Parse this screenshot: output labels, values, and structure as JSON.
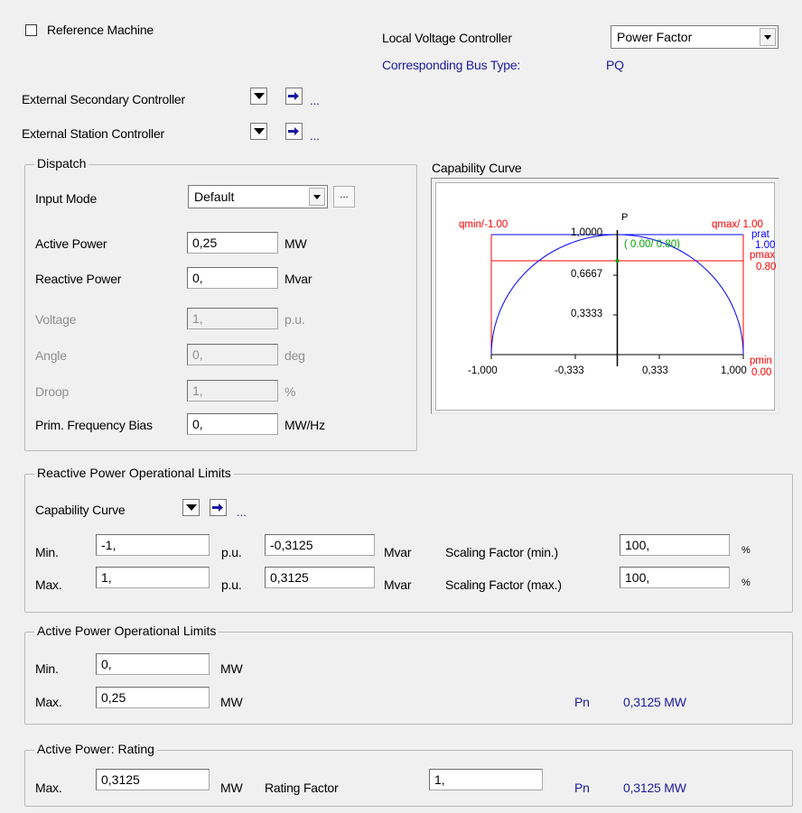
{
  "top": {
    "reference_machine_label": "Reference Machine",
    "local_voltage_controller_label": "Local Voltage Controller",
    "local_voltage_controller_value": "Power Factor",
    "bus_type_label": "Corresponding Bus Type:",
    "bus_type_value": "PQ",
    "ext_secondary_label": "External Secondary Controller",
    "ext_station_label": "External Station Controller",
    "ellipsis": "..."
  },
  "dispatch": {
    "title": "Dispatch",
    "input_mode_label": "Input Mode",
    "input_mode_value": "Default",
    "input_mode_btn": "...",
    "rows": {
      "active_power": {
        "label": "Active Power",
        "value": "0,25",
        "unit": "MW"
      },
      "reactive_power": {
        "label": "Reactive Power",
        "value": "0,",
        "unit": "Mvar"
      },
      "voltage": {
        "label": "Voltage",
        "value": "1,",
        "unit": "p.u."
      },
      "angle": {
        "label": "Angle",
        "value": "0,",
        "unit": "deg"
      },
      "droop": {
        "label": "Droop",
        "value": "1,",
        "unit": "%"
      },
      "prim_freq_bias": {
        "label": "Prim. Frequency Bias",
        "value": "0,",
        "unit": "MW/Hz"
      }
    }
  },
  "capability": {
    "title": "Capability Curve",
    "p_axis": "P",
    "qmin_label": "qmin/-1.00",
    "qmax_label": "qmax/ 1.00",
    "prat_label": "prat",
    "prat_value": "1.00",
    "pmax_label": "pmax",
    "pmax_value": "0.80",
    "pmin_label": "pmin",
    "pmin_value": "0.00",
    "operating_point": "( 0.00/ 0.80)",
    "y_ticks": [
      "1,0000",
      "0,6667",
      "0,3333"
    ],
    "x_ticks": [
      "-1,000",
      "-0,333",
      "0,333",
      "1,000"
    ]
  },
  "reactive_limits": {
    "title": "Reactive Power Operational Limits",
    "curve_label": "Capability Curve",
    "min_label": "Min.",
    "max_label": "Max.",
    "min_pu": "-1,",
    "max_pu": "1,",
    "pu_unit": "p.u.",
    "min_mvar": "-0,3125",
    "max_mvar": "0,3125",
    "mvar_unit": "Mvar",
    "scale_min_label": "Scaling Factor (min.)",
    "scale_max_label": "Scaling Factor (max.)",
    "scale_min": "100,",
    "scale_max": "100,",
    "pct_unit": "%"
  },
  "active_limits": {
    "title": "Active Power Operational Limits",
    "min_label": "Min.",
    "max_label": "Max.",
    "min_value": "0,",
    "max_value": "0,25",
    "unit": "MW",
    "pn_label": "Pn",
    "pn_value": "0,3125 MW"
  },
  "rating": {
    "title": "Active Power: Rating",
    "max_label": "Max.",
    "max_value": "0,3125",
    "unit": "MW",
    "factor_label": "Rating Factor",
    "factor_value": "1,",
    "pn_label": "Pn",
    "pn_value": "0,3125 MW"
  },
  "colors": {
    "accent_blue": "#1a1a9c",
    "curve_blue": "#0000ff",
    "curve_red": "#ff0000",
    "curve_green": "#00a000"
  }
}
